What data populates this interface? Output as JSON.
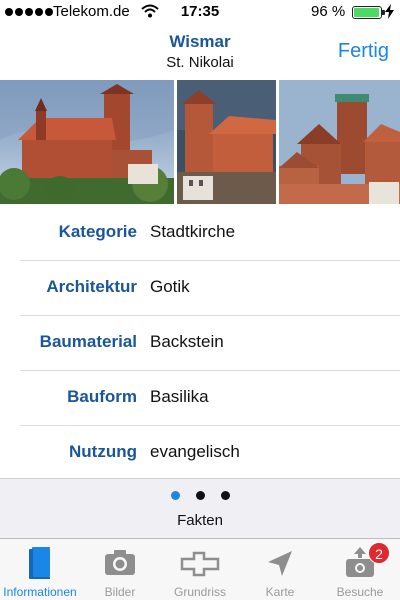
{
  "status_bar": {
    "carrier": "Telekom.de",
    "time": "17:35",
    "battery_percent": "96 %",
    "battery_level": 0.96,
    "signal_bars": 5
  },
  "nav": {
    "title": "Wismar",
    "subtitle": "St. Nikolai",
    "done_label": "Fertig"
  },
  "colors": {
    "accent": "#1a86e6",
    "label_blue": "#1a5699",
    "badge_red": "#e0282e",
    "battery_green": "#4cd964"
  },
  "photos": [
    "church-photo-1",
    "church-photo-2",
    "church-photo-3"
  ],
  "facts": [
    {
      "label": "Kategorie",
      "value": "Stadtkirche"
    },
    {
      "label": "Architektur",
      "value": "Gotik"
    },
    {
      "label": "Baumaterial",
      "value": "Backstein"
    },
    {
      "label": "Bauform",
      "value": "Basilika"
    },
    {
      "label": "Nutzung",
      "value": "evangelisch"
    }
  ],
  "pager": {
    "pages": 3,
    "current_page": 1,
    "label": "Fakten"
  },
  "tab_bar": {
    "tabs": [
      {
        "label": "Informationen",
        "icon": "book-icon",
        "active": true
      },
      {
        "label": "Bilder",
        "icon": "camera-icon",
        "active": false
      },
      {
        "label": "Grundriss",
        "icon": "floorplan-icon",
        "active": false
      },
      {
        "label": "Karte",
        "icon": "location-arrow-icon",
        "active": false
      },
      {
        "label": "Besuche",
        "icon": "camera-upload-icon",
        "active": false,
        "badge": "2"
      }
    ]
  }
}
